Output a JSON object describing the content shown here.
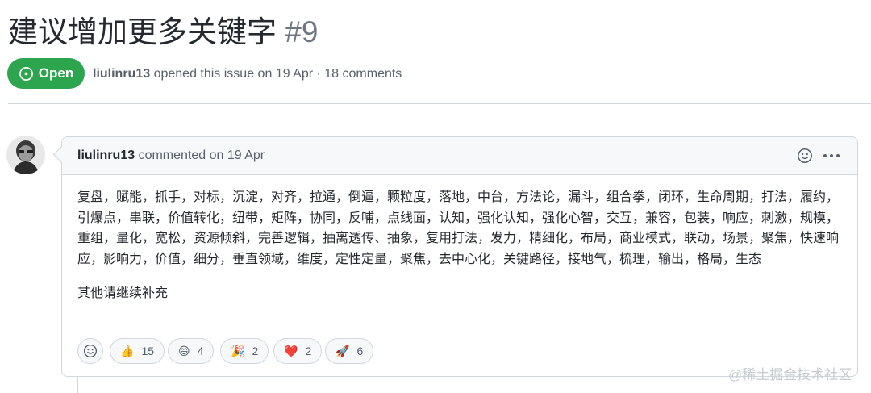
{
  "issue": {
    "title": "建议增加更多关键字",
    "number": "#9",
    "state_label": "Open",
    "author": "liulinru13",
    "meta_text": " opened this issue on 19 Apr · 18 comments"
  },
  "comment": {
    "author": "liulinru13",
    "meta_text": " commented on 19 Apr",
    "body_paragraph_1": "复盘，赋能，抓手，对标，沉淀，对齐，拉通，倒逼，颗粒度，落地，中台，方法论，漏斗，组合拳，闭环，生命周期，打法，履约，引爆点，串联，价值转化，纽带，矩阵，协同，反哺，点线面，认知，强化认知，强化心智，交互，兼容，包装，响应，刺激，规模，重组，量化，宽松，资源倾斜，完善逻辑，抽离透传、抽象，复用打法，发力，精细化，布局，商业模式，联动，场景，聚焦，快速响应，影响力，价值，细分，垂直领域，维度，定性定量，聚焦，去中心化，关键路径，接地气，梳理，输出，格局，生态",
    "body_paragraph_2": "其他请继续补充",
    "reactions": [
      {
        "icon": "thumbs-up",
        "emoji": "👍",
        "count": "15"
      },
      {
        "icon": "laugh",
        "emoji": "😄",
        "count": "4"
      },
      {
        "icon": "hooray",
        "emoji": "🎉",
        "count": "2"
      },
      {
        "icon": "heart",
        "emoji": "❤️",
        "count": "2"
      },
      {
        "icon": "rocket",
        "emoji": "🚀",
        "count": "6"
      }
    ]
  },
  "watermark": "@稀土掘金技术社区",
  "colors": {
    "open_green": "#2da44e",
    "border": "#d0d7de",
    "header_bg": "#f6f8fa",
    "muted_text": "#57606a"
  }
}
